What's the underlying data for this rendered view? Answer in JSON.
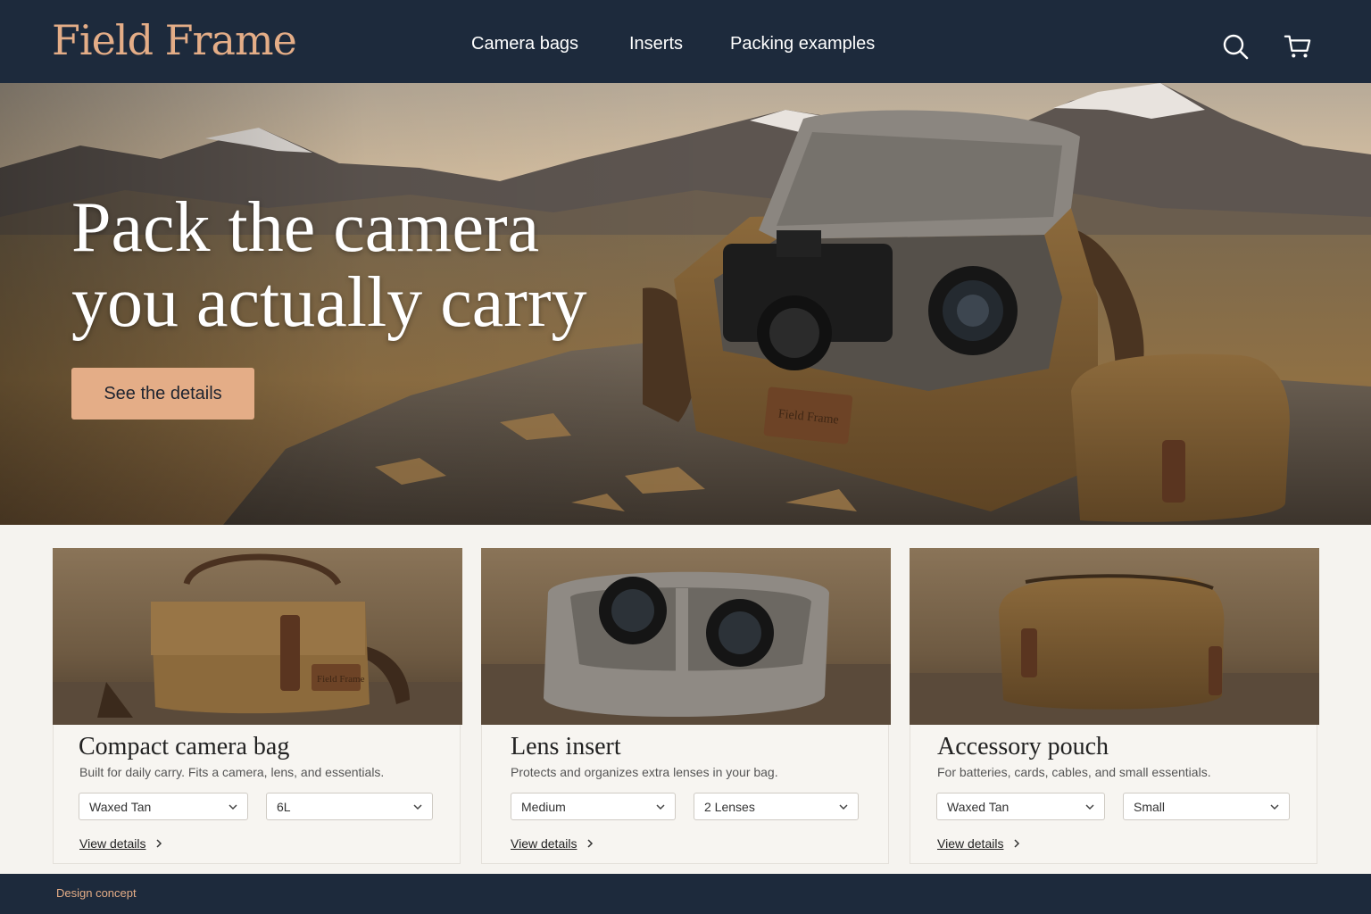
{
  "brand": {
    "name": "Field Frame"
  },
  "nav": {
    "items": [
      {
        "label": "Camera bags"
      },
      {
        "label": "Inserts"
      },
      {
        "label": "Packing examples"
      }
    ]
  },
  "header_icons": [
    "search-icon",
    "cart-icon"
  ],
  "hero": {
    "title_line1": "Pack the camera",
    "title_line2": "you actually carry",
    "cta_label": "See the details",
    "badge_text": "Field Frame"
  },
  "products": [
    {
      "title": "Compact camera bag",
      "description": "Built for daily carry. Fits a camera, lens, and essentials.",
      "options": [
        "Waxed Tan",
        "6L"
      ],
      "link_label": "View details",
      "badge_text": "Field Frame"
    },
    {
      "title": "Lens insert",
      "description": "Protects and organizes extra lenses in your bag.",
      "options": [
        "Medium",
        "2 Lenses"
      ],
      "link_label": "View details"
    },
    {
      "title": "Accessory pouch",
      "description": "For batteries, cards, cables, and small essentials.",
      "options": [
        "Waxed Tan",
        "Small"
      ],
      "link_label": "View details"
    }
  ],
  "footer": {
    "text": "Design concept"
  },
  "colors": {
    "header_bg": "#1d2a3c",
    "accent": "#e4ad87",
    "page_bg": "#f5f3ef"
  }
}
